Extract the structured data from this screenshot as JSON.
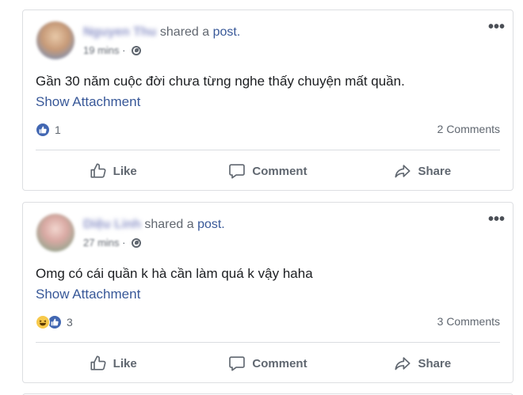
{
  "posts": [
    {
      "author": "Nguyen Thu",
      "shared_text": "shared a",
      "post_link": "post.",
      "time": "19 mins",
      "more": "•••",
      "body": "Gần 30 năm cuộc đời chưa từng nghe thấy chuyện mất quần.",
      "attachment": "Show Attachment",
      "reaction_count": "1",
      "comments": "2 Comments",
      "actions": {
        "like": "Like",
        "comment": "Comment",
        "share": "Share"
      }
    },
    {
      "author": "Diệu Linh",
      "shared_text": "shared a",
      "post_link": "post.",
      "time": "27 mins",
      "more": "•••",
      "body": "Omg có cái quần k hà cần làm quá k vậy haha",
      "attachment": "Show Attachment",
      "reaction_count": "3",
      "comments": "3 Comments",
      "actions": {
        "like": "Like",
        "comment": "Comment",
        "share": "Share"
      }
    }
  ],
  "icons": {
    "like_reaction": "like-reaction-icon",
    "haha_reaction": "haha-reaction-icon",
    "privacy": "globe-icon",
    "more": "more-options-icon",
    "like_action": "thumbs-up-icon",
    "comment_action": "comment-bubble-icon",
    "share_action": "share-arrow-icon"
  },
  "colors": {
    "link": "#385898",
    "like_blue": "#4267b2",
    "haha_yellow": "#f7c94b",
    "muted": "#606770",
    "border": "#dddfe2"
  }
}
